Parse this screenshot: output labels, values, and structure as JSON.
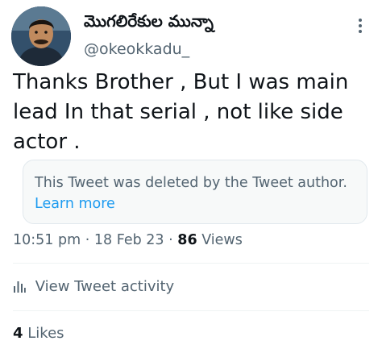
{
  "author": {
    "display_name": "మొగలిరేకుల మున్నా",
    "handle": "@okeokkadu_",
    "avatar_icon": "profile-photo"
  },
  "tweet": {
    "text": "Thanks Brother , But I was main lead In that serial , not like side actor ."
  },
  "quoted": {
    "message": "This Tweet was deleted by the Tweet author.",
    "link_label": "Learn more"
  },
  "meta": {
    "time": "10:51 pm",
    "separator": "·",
    "date": "18 Feb 23",
    "views_count": "86",
    "views_label": "Views"
  },
  "actions": {
    "activity_icon": "bar-chart-icon",
    "activity_label": "View Tweet activity"
  },
  "likes": {
    "count": "4",
    "label": "Likes"
  },
  "colors": {
    "text_primary": "#0f1419",
    "text_secondary": "#536471",
    "link": "#1d9bf0",
    "quote_bg": "#f7f9f9",
    "divider": "#eff3f4"
  }
}
